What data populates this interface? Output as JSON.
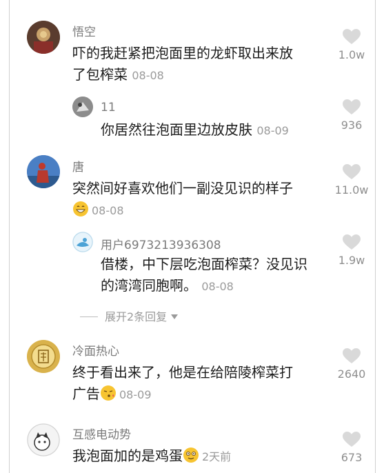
{
  "comments": [
    {
      "author": "悟空",
      "line1": "吓的我赶紧把泡面里的龙虾取出来放",
      "line2": "了包榨菜",
      "date": "08-08",
      "likes": "1.0w",
      "reply": {
        "author": "11",
        "text": "你居然往泡面里边放皮肤",
        "date": "08-09",
        "likes": "936"
      }
    },
    {
      "author": "唐",
      "line1": "突然间好喜欢他们一副没见识的样子",
      "date": "08-08",
      "likes": "11.0w",
      "reply": {
        "author": "用户6973213936308",
        "line1": "借楼，中下层吃泡面榨菜？没见识",
        "line2": "的湾湾同胞啊。",
        "date": "08-08",
        "likes": "1.9w"
      },
      "expand_label": "展开2条回复"
    },
    {
      "author": "冷面热心",
      "line1": "终于看出来了，他是在给陪陵榨菜打",
      "line2": "广告",
      "date": "08-09",
      "likes": "2640"
    },
    {
      "author": "互感电动势",
      "line1": "我泡面加的是鸡蛋",
      "date": "2天前",
      "likes": "673"
    }
  ],
  "icons": {
    "like": "heart-icon",
    "expand": "caret-down-icon",
    "emoji_grin": "grinning-emoji-icon",
    "emoji_kiss": "kissing-emoji-icon",
    "emoji_smile": "smiling-emoji-icon"
  },
  "colors": {
    "text": "#1c1c1c",
    "meta": "#9a9a9a",
    "heart": "#d9d9d9"
  }
}
